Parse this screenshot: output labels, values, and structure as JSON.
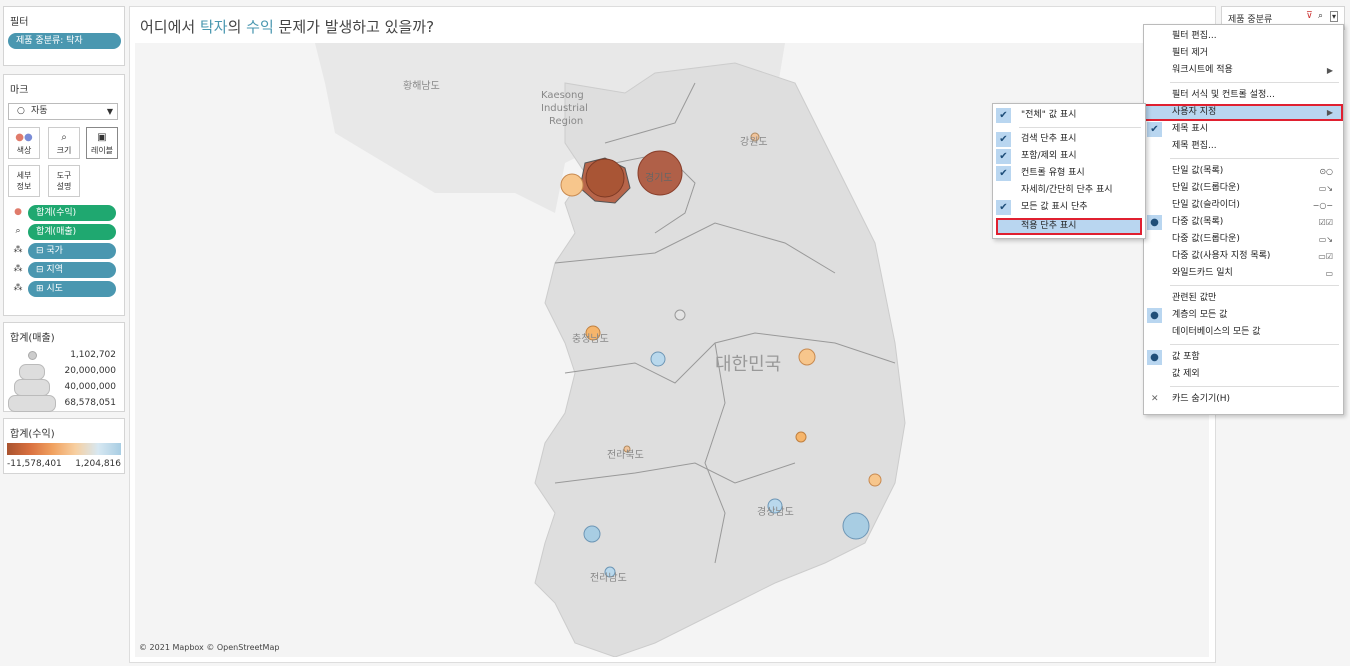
{
  "filters": {
    "title": "필터",
    "pill": "제품 중분류: 탁자"
  },
  "marks": {
    "title": "마크",
    "type": "자동",
    "buttons": {
      "color": "색상",
      "size": "크기",
      "label": "레이블",
      "detail1": "세부",
      "detail2": "정보",
      "tooltip1": "도구",
      "tooltip2": "설명"
    },
    "pills": [
      "합계(수익)",
      "합계(매출)",
      "⊟ 국가",
      "⊟ 지역",
      "⊞ 시도"
    ]
  },
  "size_legend": {
    "title": "합계(매출)",
    "values": [
      "1,102,702",
      "20,000,000",
      "40,000,000",
      "68,578,051"
    ]
  },
  "color_legend": {
    "title": "합계(수익)",
    "min": "-11,578,401",
    "max": "1,204,816",
    "colors": [
      "#a9532f",
      "#e57f47",
      "#f4b36a",
      "#f7cfa0",
      "#cfe3ef",
      "#a8cde3"
    ]
  },
  "view": {
    "title_parts": [
      "어디에서 ",
      "탁자",
      "의 ",
      "수익",
      " 문제가 발생하고 있을까?"
    ],
    "attribution": "© 2021 Mapbox © OpenStreetMap",
    "map_labels": {
      "hwanghae": "황해남도",
      "kaesong": "Kaesong",
      "industrial": "Industrial",
      "region": "Region",
      "gangwon": "강원도",
      "gyeonggi": "경기도",
      "chungnam": "충청남도",
      "korea": "대한민국",
      "jeonbuk": "전라북도",
      "gyeongnam": "경상남도",
      "jeonnam": "전라남도"
    }
  },
  "filter_card": {
    "title": "제품 중분류"
  },
  "context_menu": {
    "items": [
      "필터 편집...",
      "필터 제거",
      "워크시트에 적용",
      "필터 서식 및 컨트롤 설정...",
      "사용자 지정",
      "제목 표시",
      "제목 편집...",
      "단일 값(목록)",
      "단일 값(드롭다운)",
      "단일 값(슬라이더)",
      "다중 값(목록)",
      "다중 값(드롭다운)",
      "다중 값(사용자 지정 목록)",
      "와일드카드 일치",
      "관련된 값만",
      "계층의 모든 값",
      "데이터베이스의 모든 값",
      "값 포함",
      "값 제외",
      "카드 숨기기(H)"
    ]
  },
  "submenu": {
    "items": [
      "\"전체\" 값 표시",
      "검색 단추 표시",
      "포함/제외 표시",
      "컨트롤 유형 표시",
      "자세히/간단히 단추 표시",
      "모든 값 표시 단추",
      "적용 단추 표시"
    ]
  }
}
